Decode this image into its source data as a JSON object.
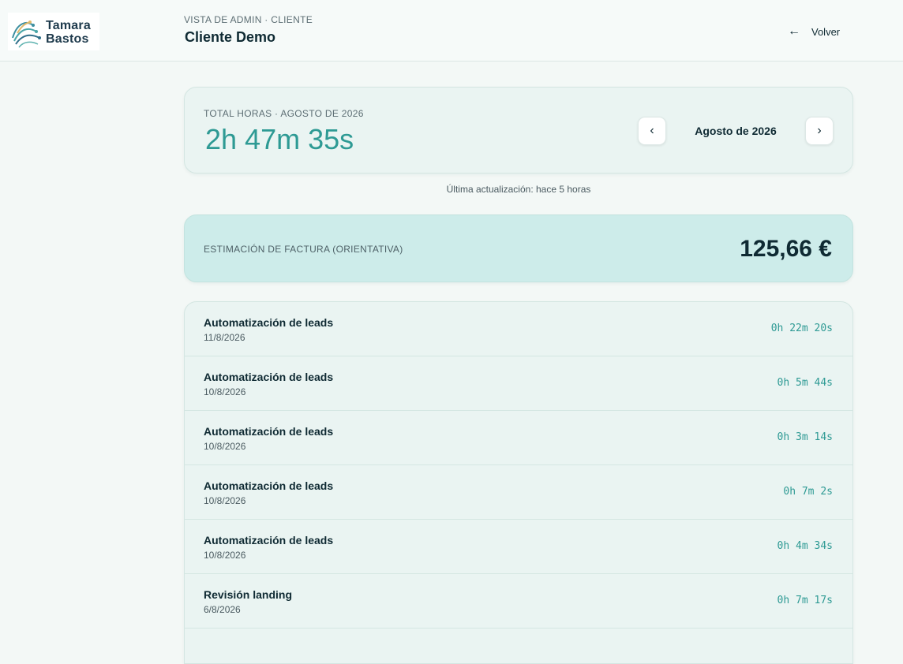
{
  "brand": {
    "line1": "Tamara",
    "line2": "Bastos"
  },
  "header": {
    "subtitle": "VISTA DE ADMIN · CLIENTE",
    "title": "Cliente Demo",
    "back_label": "Volver",
    "back_icon": "arrow-left-icon"
  },
  "hours": {
    "label": "TOTAL HORAS · AGOSTO DE 2026",
    "value": "2h 47m 35s",
    "month": "Agosto de 2026",
    "prev_icon": "chevron-left-icon",
    "next_icon": "chevron-right-icon"
  },
  "last_update": "Última actualización: hace 5 horas",
  "invoice": {
    "label": "ESTIMACIÓN DE FACTURA (ORIENTATIVA)",
    "value": "125,66 €"
  },
  "entries": [
    {
      "title": "Automatización de leads",
      "date": "11/8/2026",
      "duration": "0h 22m 20s"
    },
    {
      "title": "Automatización de leads",
      "date": "10/8/2026",
      "duration": "0h 5m 44s"
    },
    {
      "title": "Automatización de leads",
      "date": "10/8/2026",
      "duration": "0h 3m 14s"
    },
    {
      "title": "Automatización de leads",
      "date": "10/8/2026",
      "duration": "0h 7m 2s"
    },
    {
      "title": "Automatización de leads",
      "date": "10/8/2026",
      "duration": "0h 4m 34s"
    },
    {
      "title": "Revisión landing",
      "date": "6/8/2026",
      "duration": "0h 7m 17s"
    }
  ],
  "colors": {
    "accent": "#2e9a94",
    "background": "#f3f8f6",
    "card": "#eaf4f2",
    "invoice_card": "#cdecea",
    "text": "#0f2a33"
  }
}
